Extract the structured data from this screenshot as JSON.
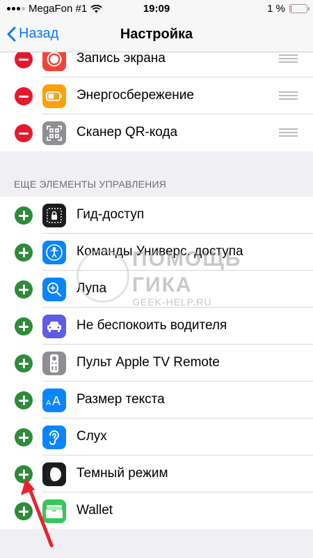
{
  "status": {
    "carrier": "MegaFon #1",
    "time": "19:09",
    "battery": "1 %",
    "battery_level_percent": 1
  },
  "nav": {
    "back_label": "Назад",
    "title": "Настройка"
  },
  "included": [
    {
      "label": "Запись экрана",
      "icon": "screen-record-icon",
      "color": "#f44336"
    },
    {
      "label": "Энергосбережение",
      "icon": "low-power-battery-icon",
      "color": "#ff9f0a"
    },
    {
      "label": "Сканер QR-кода",
      "icon": "qr-scanner-icon",
      "color": "#8e8e93"
    }
  ],
  "more_header": "ЕЩЕ ЭЛЕМЕНТЫ УПРАВЛЕНИЯ",
  "more": [
    {
      "label": "Гид-доступ",
      "icon": "guided-access-lock-icon",
      "color": "#1c1c1e"
    },
    {
      "label": "Команды Универс. доступа",
      "icon": "accessibility-icon",
      "color": "#0a84ff"
    },
    {
      "label": "Лупа",
      "icon": "magnifier-icon",
      "color": "#0a84ff"
    },
    {
      "label": "Не беспокоить водителя",
      "icon": "car-icon",
      "color": "#5e5ce6"
    },
    {
      "label": "Пульт Apple TV Remote",
      "icon": "tv-remote-icon",
      "color": "#8e8e93"
    },
    {
      "label": "Размер текста",
      "icon": "text-size-icon",
      "color": "#0a84ff"
    },
    {
      "label": "Слух",
      "icon": "ear-icon",
      "color": "#0a84ff"
    },
    {
      "label": "Темный режим",
      "icon": "dark-mode-icon",
      "color": "#1c1c1e"
    },
    {
      "label": "Wallet",
      "icon": "wallet-icon",
      "color": "#34c759"
    }
  ],
  "watermark": {
    "line1": "ПОМОЩЬ",
    "line2": "ГИКА",
    "line3": "GEEK-HELP.RU"
  }
}
